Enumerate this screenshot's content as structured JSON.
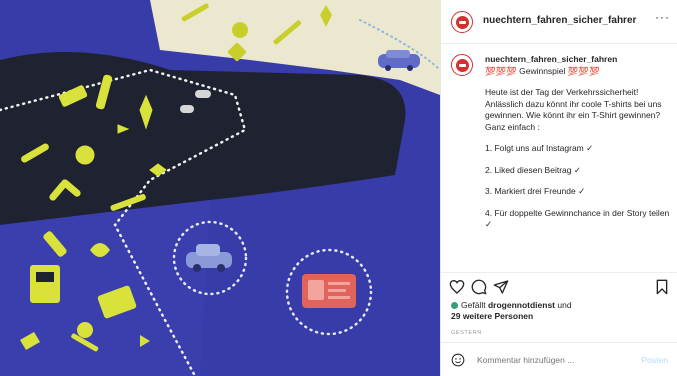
{
  "header": {
    "username": "nuechtern_fahren_sicher_fahrer",
    "more_label": "···"
  },
  "caption": {
    "username": "nuechtern_fahren_sicher_fahren",
    "title": "💯💯💯 Gewinnspiel 💯💯💯",
    "intro": "Heute ist der Tag der Verkehrssicherheit! Anlässlich dazu könnt ihr coole T-shirts bei uns gewinnen. Wie könnt ihr ein T-Shirt gewinnen?",
    "simple": "Ganz einfach :",
    "steps": [
      "1. Folgt uns auf Instagram ✓",
      "2. Liked diesen Beitrag ✓",
      "3. Markiert drei Freunde ✓",
      "4. Für doppelte Gewinnchance in der Story teilen ✓"
    ]
  },
  "likes": {
    "prefix": "Gefällt",
    "user": "drogennotdienst",
    "middle": "und",
    "others": "29 weitere Personen"
  },
  "date": "GESTERN",
  "comment": {
    "placeholder": "Kommentar hinzufügen ...",
    "post_label": "Posten"
  },
  "colors": {
    "brand_red": "#d32f2f",
    "link_blue": "#b3dbff",
    "photo_blue": "#3b3fae",
    "shirt_dark": "#1f2230",
    "shirt_cream": "#ece8cf",
    "print_yellow": "#d9e23a"
  },
  "icons": {
    "like": "heart-icon",
    "comment": "comment-icon",
    "share": "paper-plane-icon",
    "save": "bookmark-icon",
    "emoji": "smiley-icon"
  }
}
